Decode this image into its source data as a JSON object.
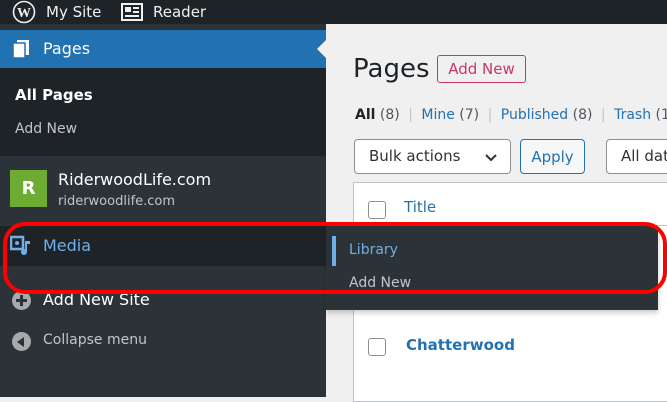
{
  "adminbar": {
    "site_label": "My Site",
    "reader_label": "Reader"
  },
  "sidebar": {
    "pages_label": "Pages",
    "pages_submenu": {
      "all_pages": "All Pages",
      "add_new": "Add New"
    },
    "site": {
      "avatar_letter": "R",
      "title": "RiderwoodLife.com",
      "url": "riderwoodlife.com"
    },
    "media_label": "Media",
    "add_new_site": "Add New Site",
    "collapse_menu": "Collapse menu"
  },
  "flyout": {
    "library": "Library",
    "add_new": "Add New"
  },
  "main": {
    "title": "Pages",
    "add_new": "Add New",
    "status_links": [
      {
        "label": "All",
        "count": "(8)"
      },
      {
        "label": "Mine",
        "count": "(7)"
      },
      {
        "label": "Published",
        "count": "(8)"
      },
      {
        "label": "Trash",
        "count": "(1"
      }
    ],
    "bulk_actions": "Bulk actions",
    "apply": "Apply",
    "dates_filter": "All dat",
    "table": {
      "title_header": "Title",
      "rows": [
        "Chatterwood"
      ]
    }
  },
  "colors": {
    "sidebar": "#2c3338",
    "active": "#2271b1",
    "accent": "#72aee6",
    "highlight": "#ff0000",
    "brand_pink": "#c9356e"
  }
}
